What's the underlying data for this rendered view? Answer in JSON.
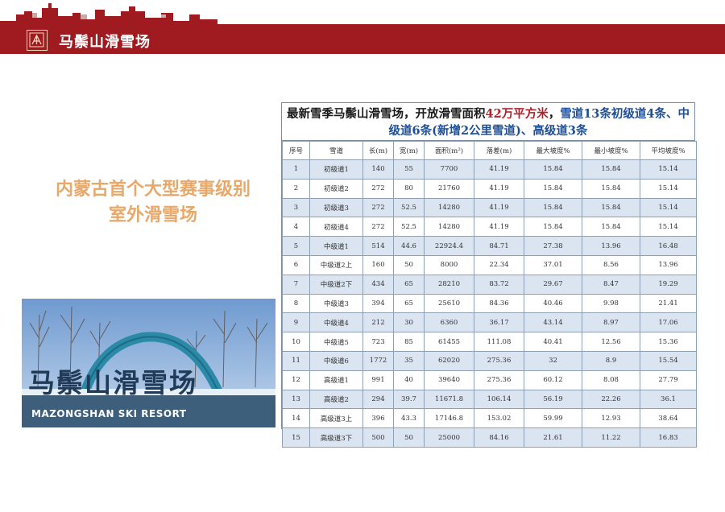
{
  "header": {
    "brand_name": "马鬃山滑雪场",
    "colors": {
      "bar": "#a01b20",
      "headline": "#e8a86a",
      "title_red": "#b02128",
      "title_blue": "#1f4f96",
      "row_stripe": "#dbe5f1"
    }
  },
  "headline": {
    "line1": "内蒙古首个大型赛事级别",
    "line2": "室外滑雪场"
  },
  "photo": {
    "sign_text": "马鬃山滑雪场",
    "sign_subtitle": "MAZONGSHAN SKI RESORT"
  },
  "table": {
    "title_part1": "最新雪季马鬃山滑雪场，开放滑雪面积",
    "title_area": "42万平方米",
    "title_part2": "，",
    "title_part3": "雪道13条初级道4条、中级道6条(新增2公里雪道)、高级道3条",
    "columns": [
      "序号",
      "雪道",
      "长(m)",
      "宽(m)",
      "面积(m²)",
      "落差(m)",
      "最大坡度%",
      "最小坡度%",
      "平均坡度%"
    ],
    "rows": [
      [
        "1",
        "初级道1",
        "140",
        "55",
        "7700",
        "41.19",
        "15.84",
        "15.84",
        "15.14"
      ],
      [
        "2",
        "初级道2",
        "272",
        "80",
        "21760",
        "41.19",
        "15.84",
        "15.84",
        "15.14"
      ],
      [
        "3",
        "初级道3",
        "272",
        "52.5",
        "14280",
        "41.19",
        "15.84",
        "15.84",
        "15.14"
      ],
      [
        "4",
        "初级道4",
        "272",
        "52.5",
        "14280",
        "41.19",
        "15.84",
        "15.84",
        "15.14"
      ],
      [
        "5",
        "中级道1",
        "514",
        "44.6",
        "22924.4",
        "84.71",
        "27.38",
        "13.96",
        "16.48"
      ],
      [
        "6",
        "中级道2上",
        "160",
        "50",
        "8000",
        "22.34",
        "37.01",
        "8.56",
        "13.96"
      ],
      [
        "7",
        "中级道2下",
        "434",
        "65",
        "28210",
        "83.72",
        "29.67",
        "8.47",
        "19.29"
      ],
      [
        "8",
        "中级道3",
        "394",
        "65",
        "25610",
        "84.36",
        "40.46",
        "9.98",
        "21.41"
      ],
      [
        "9",
        "中级道4",
        "212",
        "30",
        "6360",
        "36.17",
        "43.14",
        "8.97",
        "17.06"
      ],
      [
        "10",
        "中级道5",
        "723",
        "85",
        "61455",
        "111.08",
        "40.41",
        "12.56",
        "15.36"
      ],
      [
        "11",
        "中级道6",
        "1772",
        "35",
        "62020",
        "275.36",
        "32",
        "8.9",
        "15.54"
      ],
      [
        "12",
        "高级道1",
        "991",
        "40",
        "39640",
        "275.36",
        "60.12",
        "8.08",
        "27.79"
      ],
      [
        "13",
        "高级道2",
        "294",
        "39.7",
        "11671.8",
        "106.14",
        "56.19",
        "22.26",
        "36.1"
      ],
      [
        "14",
        "高级道3上",
        "396",
        "43.3",
        "17146.8",
        "153.02",
        "59.99",
        "12.93",
        "38.64"
      ],
      [
        "15",
        "高级道3下",
        "500",
        "50",
        "25000",
        "84.16",
        "21.61",
        "11.22",
        "16.83"
      ]
    ]
  }
}
